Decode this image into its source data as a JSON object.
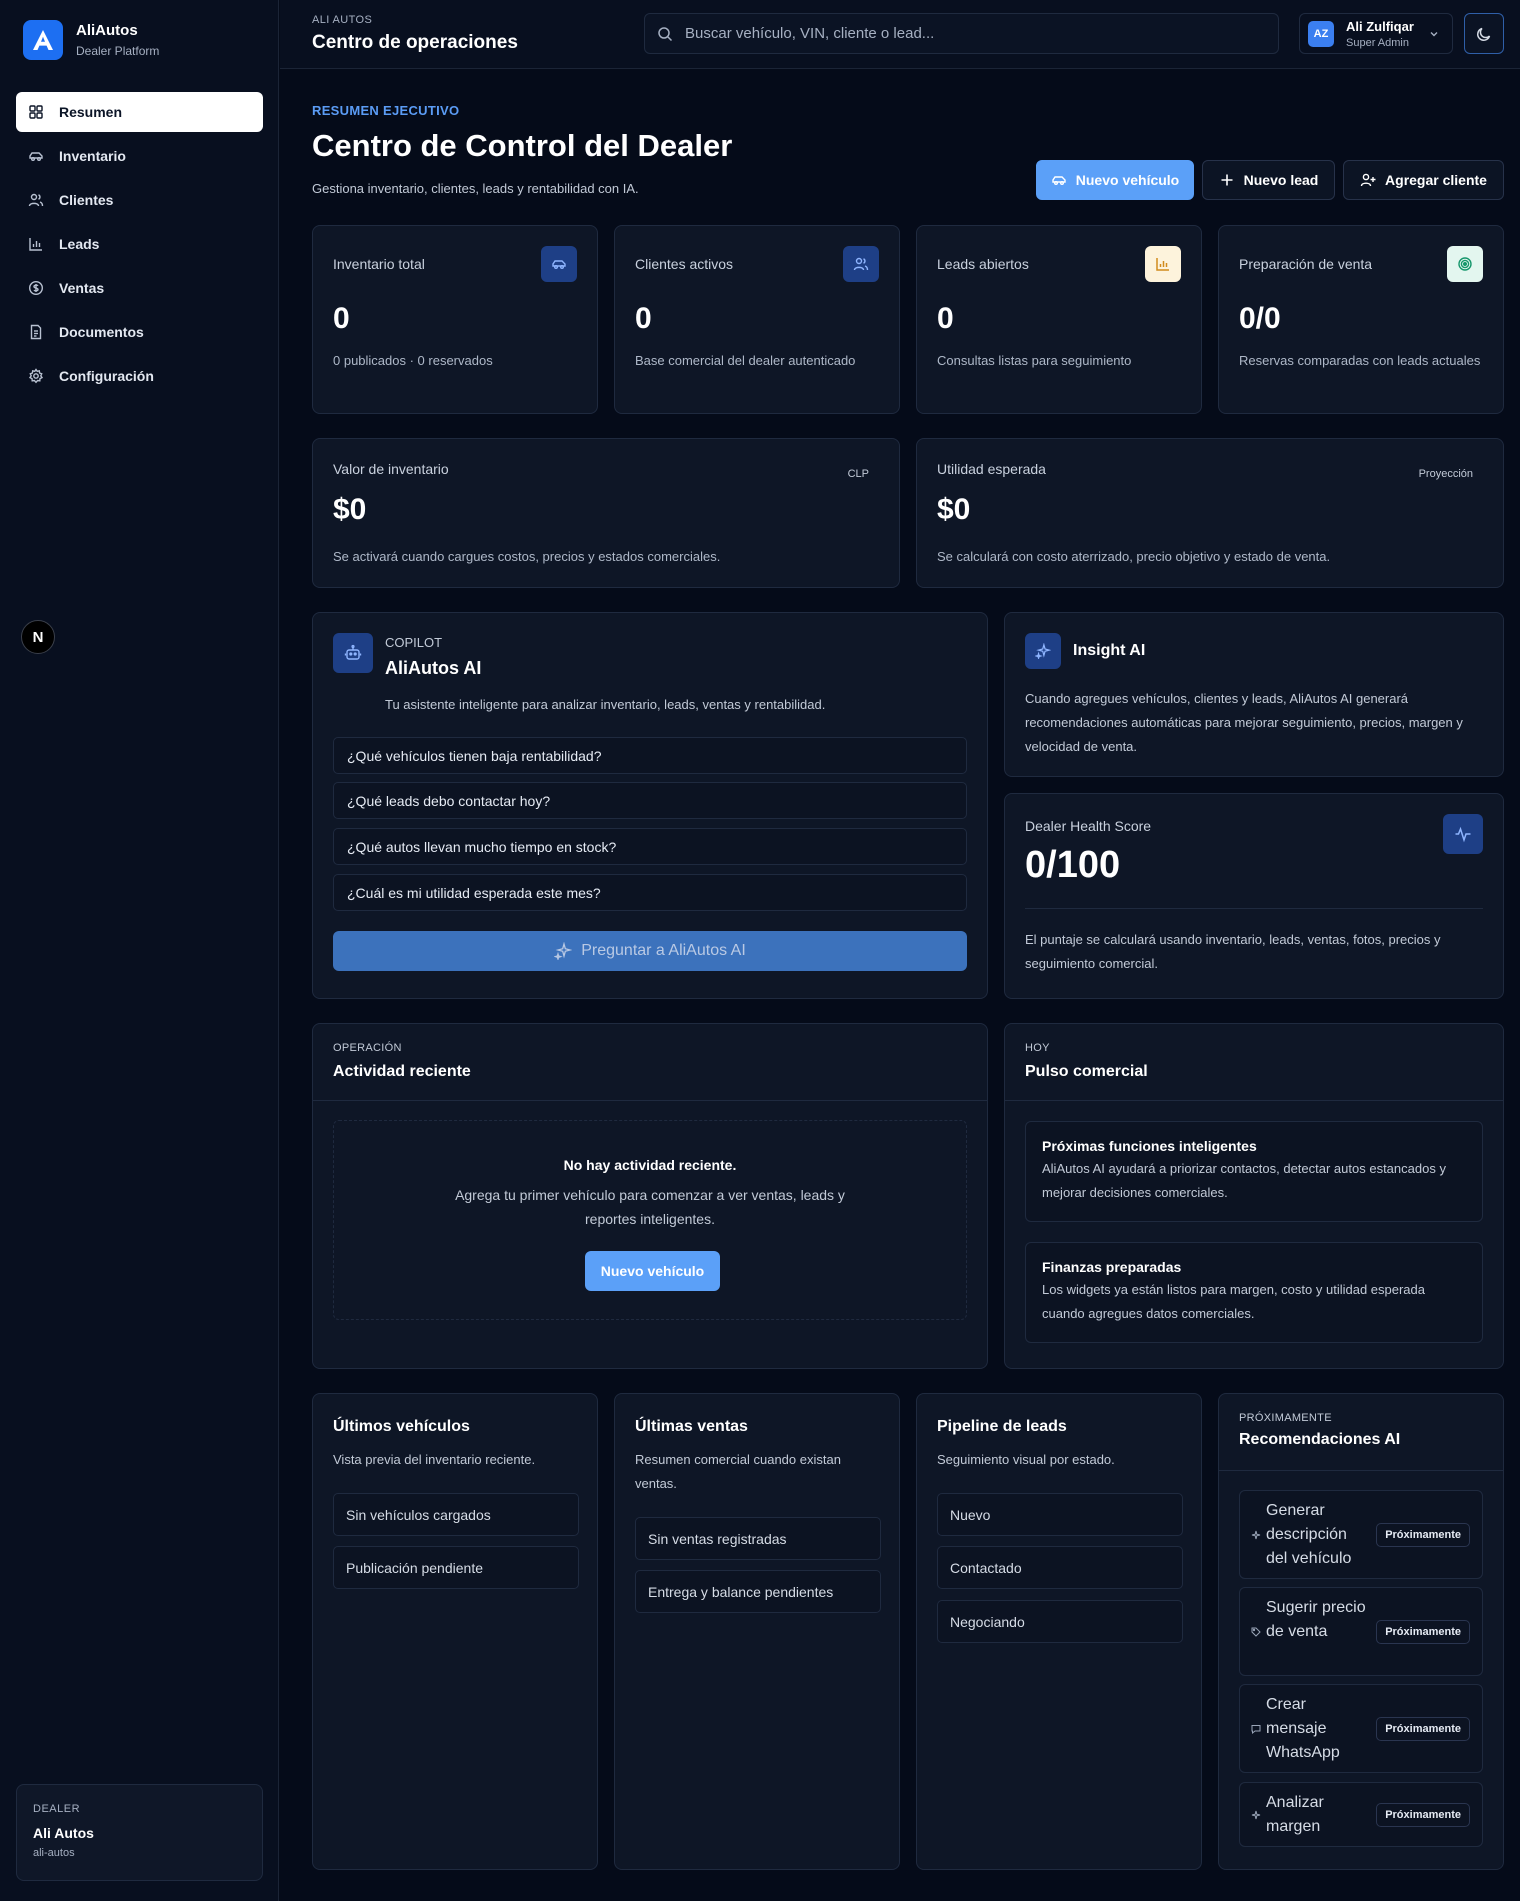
{
  "brand": {
    "name": "AliAutos",
    "subtitle": "Dealer Platform"
  },
  "sidebar": {
    "items": [
      {
        "label": "Resumen",
        "icon": "dashboard-icon",
        "active": true
      },
      {
        "label": "Inventario",
        "icon": "car-icon"
      },
      {
        "label": "Clientes",
        "icon": "users-icon"
      },
      {
        "label": "Leads",
        "icon": "bar-chart-icon"
      },
      {
        "label": "Ventas",
        "icon": "dollar-icon"
      },
      {
        "label": "Documentos",
        "icon": "document-icon"
      },
      {
        "label": "Configuración",
        "icon": "gear-icon"
      }
    ],
    "next_badge": "N",
    "dealer": {
      "label": "DEALER",
      "name": "Ali Autos",
      "slug": "ali-autos"
    }
  },
  "header": {
    "kicker": "ALI AUTOS",
    "title": "Centro de operaciones",
    "search_placeholder": "Buscar vehículo, VIN, cliente o lead...",
    "user": {
      "initials": "AZ",
      "name": "Ali Zulfiqar",
      "role": "Super Admin"
    }
  },
  "page": {
    "kicker": "RESUMEN EJECUTIVO",
    "title": "Centro de Control del Dealer",
    "subtitle": "Gestiona inventario, clientes, leads y rentabilidad con IA.",
    "actions": {
      "new_vehicle": "Nuevo vehículo",
      "new_lead": "Nuevo lead",
      "add_client": "Agregar cliente"
    }
  },
  "stats": [
    {
      "label": "Inventario total",
      "value": "0",
      "desc": "0 publicados · 0 reservados",
      "icon": "car-icon",
      "tone": "blue"
    },
    {
      "label": "Clientes activos",
      "value": "0",
      "desc": "Base comercial del dealer autenticado",
      "icon": "users-icon",
      "tone": "blue"
    },
    {
      "label": "Leads abiertos",
      "value": "0",
      "desc": "Consultas listas para seguimiento",
      "icon": "bar-chart-icon",
      "tone": "amber"
    },
    {
      "label": "Preparación de venta",
      "value": "0/0",
      "desc": "Reservas comparadas con leads actuales",
      "icon": "target-icon",
      "tone": "green"
    }
  ],
  "values": [
    {
      "label": "Valor de inventario",
      "tag": "CLP",
      "amount": "$0",
      "desc": "Se activará cuando cargues costos, precios y estados comerciales."
    },
    {
      "label": "Utilidad esperada",
      "tag": "Proyección",
      "amount": "$0",
      "desc": "Se calculará con costo aterrizado, precio objetivo y estado de venta."
    }
  ],
  "copilot": {
    "kicker": "COPILOT",
    "title": "AliAutos AI",
    "desc": "Tu asistente inteligente para analizar inventario, leads, ventas y rentabilidad.",
    "questions": [
      "¿Qué vehículos tienen baja rentabilidad?",
      "¿Qué leads debo contactar hoy?",
      "¿Qué autos llevan mucho tiempo en stock?",
      "¿Cuál es mi utilidad esperada este mes?"
    ],
    "ask_label": "Preguntar a AliAutos AI"
  },
  "insight": {
    "title": "Insight AI",
    "desc": "Cuando agregues vehículos, clientes y leads, AliAutos AI generará recomendaciones automáticas para mejorar seguimiento, precios, margen y velocidad de venta."
  },
  "health": {
    "label": "Dealer Health Score",
    "value": "0/100",
    "desc": "El puntaje se calculará usando inventario, leads, ventas, fotos, precios y seguimiento comercial."
  },
  "activity": {
    "kicker": "OPERACIÓN",
    "title": "Actividad reciente",
    "empty_title": "No hay actividad reciente.",
    "empty_desc": "Agrega tu primer vehículo para comenzar a ver ventas, leads y reportes inteligentes.",
    "empty_button": "Nuevo vehículo"
  },
  "pulse": {
    "kicker": "HOY",
    "title": "Pulso comercial",
    "items": [
      {
        "title": "Próximas funciones inteligentes",
        "desc": "AliAutos AI ayudará a priorizar contactos, detectar autos estancados y mejorar decisiones comerciales."
      },
      {
        "title": "Finanzas preparadas",
        "desc": "Los widgets ya están listos para margen, costo y utilidad esperada cuando agregues datos comerciales."
      }
    ]
  },
  "vehicles": {
    "title": "Últimos vehículos",
    "desc": "Vista previa del inventario reciente.",
    "rows": [
      "Sin vehículos cargados",
      "Publicación pendiente"
    ]
  },
  "sales": {
    "title": "Últimas ventas",
    "desc": "Resumen comercial cuando existan ventas.",
    "rows": [
      "Sin ventas registradas",
      "Entrega y balance pendientes"
    ]
  },
  "pipeline": {
    "title": "Pipeline de leads",
    "desc": "Seguimiento visual por estado.",
    "rows": [
      "Nuevo",
      "Contactado",
      "Negociando"
    ]
  },
  "recommendations": {
    "kicker": "PRÓXIMAMENTE",
    "title": "Recomendaciones AI",
    "items": [
      {
        "label": "Generar descripción del vehículo",
        "badge": "Próximamente",
        "icon": "sparkle-icon"
      },
      {
        "label": "Sugerir precio de venta",
        "badge": "Próximamente",
        "icon": "tag-icon"
      },
      {
        "label": "Crear mensaje WhatsApp",
        "badge": "Próximamente",
        "icon": "message-icon"
      },
      {
        "label": "Analizar margen",
        "badge": "Próximamente",
        "icon": "sparkle-icon"
      }
    ]
  }
}
